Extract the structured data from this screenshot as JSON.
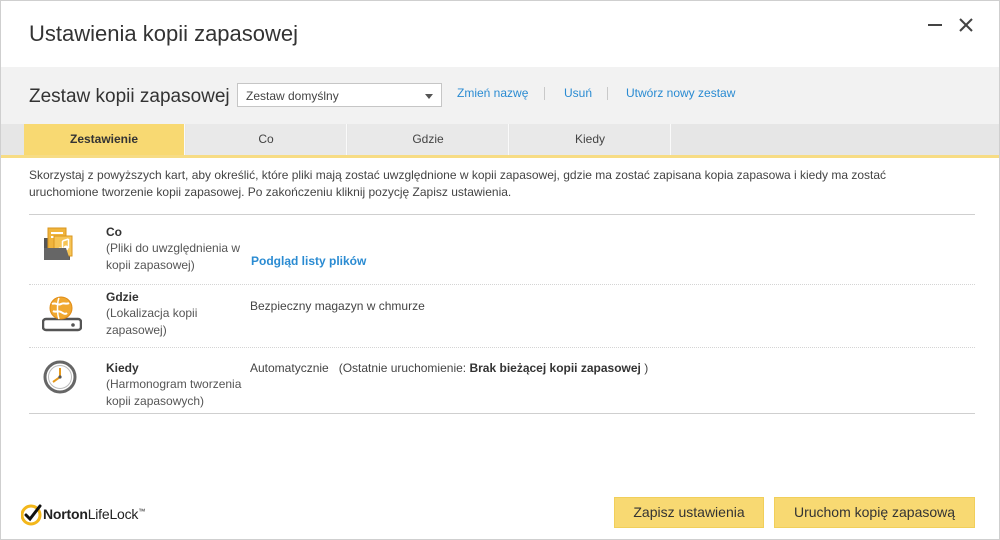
{
  "window": {
    "title": "Ustawienia kopii zapasowej"
  },
  "set": {
    "label": "Zestaw kopii zapasowej",
    "selected": "Zestaw domyślny",
    "links": {
      "rename": "Zmień nazwę",
      "delete": "Usuń",
      "create": "Utwórz nowy zestaw"
    }
  },
  "tabs": [
    {
      "label": "Zestawienie",
      "active": true
    },
    {
      "label": "Co",
      "active": false
    },
    {
      "label": "Gdzie",
      "active": false
    },
    {
      "label": "Kiedy",
      "active": false
    }
  ],
  "description": "Skorzystaj z powyższych kart, aby określić, które pliki mają zostać uwzględnione w kopii zapasowej, gdzie ma zostać zapisana kopia zapasowa i kiedy ma zostać uruchomione tworzenie kopii zapasowej. Po zakończeniu kliknij pozycję Zapisz ustawienia.",
  "rows": {
    "what": {
      "title": "Co",
      "subtitle": "(Pliki do uwzględnienia w kopii zapasowej)",
      "link": "Podgląd listy plików",
      "icon": "files-folder-icon"
    },
    "where": {
      "title": "Gdzie",
      "subtitle": "(Lokalizacja kopii zapasowej)",
      "value": "Bezpieczny magazyn w chmurze",
      "icon": "cloud-drive-icon"
    },
    "when": {
      "title": "Kiedy",
      "subtitle": "(Harmonogram tworzenia kopii zapasowych)",
      "value_prefix": "Automatycznie",
      "value_middle": "(Ostatnie uruchomienie:",
      "value_bold": "Brak bieżącej kopii zapasowej",
      "value_suffix": ")",
      "icon": "clock-icon"
    }
  },
  "footer": {
    "brand_part1": "Norton",
    "brand_part2": "LifeLock",
    "tm": "™",
    "save_button": "Zapisz ustawienia",
    "run_button": "Uruchom kopię zapasową"
  },
  "colors": {
    "accent": "#f8d972",
    "link": "#2a8bd2"
  }
}
